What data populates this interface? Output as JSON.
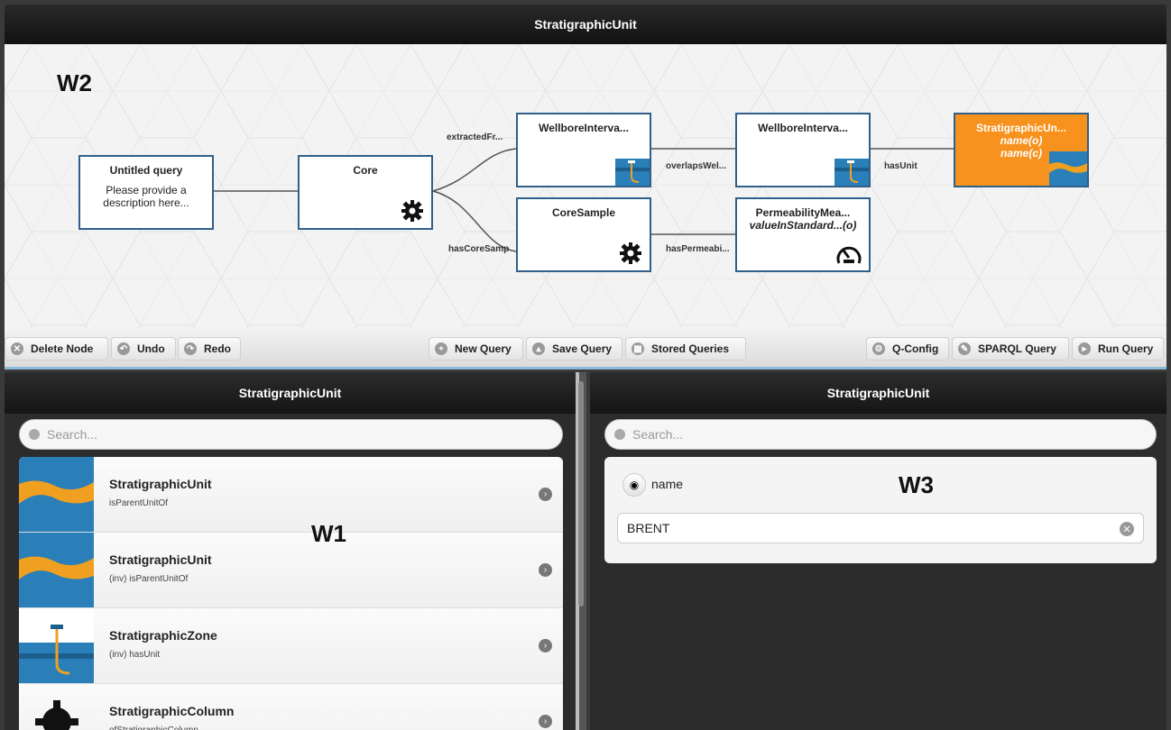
{
  "title": "StratigraphicUnit",
  "canvas": {
    "window_label": "W2",
    "nodes": {
      "untitled": {
        "title": "Untitled query",
        "desc": "Please provide a description here..."
      },
      "core": {
        "title": "Core"
      },
      "wellbore1": {
        "title": "WellboreInterva..."
      },
      "coresample": {
        "title": "CoreSample"
      },
      "wellbore2": {
        "title": "WellboreInterva..."
      },
      "perm": {
        "title": "PermeabilityMea...",
        "sub": "valueInStandard...(o)"
      },
      "strat": {
        "title": "StratigraphicUn...",
        "sub1": "name(o)",
        "sub2": "name(c)"
      }
    },
    "edges": {
      "extracted": "extractedFr...",
      "hascore": "hasCoreSamp",
      "overlaps": "overlapsWel...",
      "hasperm": "hasPermeabi...",
      "hasunit": "hasUnit"
    }
  },
  "toolbar": {
    "delete": "Delete Node",
    "undo": "Undo",
    "redo": "Redo",
    "new_query": "New Query",
    "save_query": "Save Query",
    "stored": "Stored Queries",
    "qconfig": "Q-Config",
    "sparql": "SPARQL Query",
    "run": "Run Query"
  },
  "left_panel": {
    "title": "StratigraphicUnit",
    "window_label": "W1",
    "search_placeholder": "Search...",
    "items": [
      {
        "title": "StratigraphicUnit",
        "sub": "isParentUnitOf"
      },
      {
        "title": "StratigraphicUnit",
        "sub": "(inv) isParentUnitOf"
      },
      {
        "title": "StratigraphicZone",
        "sub": "(inv) hasUnit"
      },
      {
        "title": "StratigraphicColumn",
        "sub": "ofStratigraphicColumn"
      }
    ]
  },
  "right_panel": {
    "title": "StratigraphicUnit",
    "window_label": "W3",
    "search_placeholder": "Search...",
    "property_name": "name",
    "property_value": "BRENT"
  },
  "colors": {
    "accent_orange": "#f7921e",
    "node_border": "#2f5f8a",
    "water_blue": "#2a7fb8",
    "sand": "#f0a020"
  }
}
